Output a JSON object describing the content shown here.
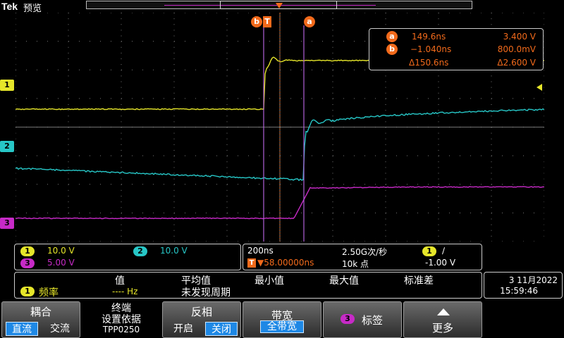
{
  "header": {
    "brand": "Tek",
    "mode": "预览"
  },
  "colors": {
    "ch1": "#e6e62a",
    "ch2": "#27c7c7",
    "ch3": "#c72ac7",
    "cursor": "#f26a1b",
    "grid": "#7a7a7a",
    "cursor_line": "#b060d8",
    "select": "#1e88e5"
  },
  "channel_markers": {
    "ch1": "1",
    "ch2": "2",
    "ch3": "3"
  },
  "trigger_marker": "T",
  "cursor_tags": {
    "a": "a",
    "b": "b"
  },
  "cursor_readout": {
    "a_time": "149.6ns",
    "a_value": "3.400 V",
    "b_time": "−1.040ns",
    "b_value": "800.0mV",
    "delta_time": "Δ150.6ns",
    "delta_value": "Δ2.600 V"
  },
  "channels": [
    {
      "id": "1",
      "scale": "10.0 V"
    },
    {
      "id": "2",
      "scale": "10.0 V"
    },
    {
      "id": "3",
      "scale": "5.00 V"
    }
  ],
  "timebase": {
    "scale": "200ns",
    "sample_rate": "2.50G次/秒",
    "trigger_position": "▼58.00000ns",
    "record_length": "10k 点",
    "trigger_source": "1",
    "trigger_slope": "∕",
    "trigger_level": "-1.00 V"
  },
  "measurement": {
    "headers": {
      "value": "值",
      "mean": "平均值",
      "min": "最小值",
      "max": "最大值",
      "std": "标准差"
    },
    "source": "1",
    "name": "频率",
    "value": "---- Hz",
    "mean": "未发现周期"
  },
  "clock": {
    "date": "3 11月2022",
    "time": "15:59:46"
  },
  "menu": {
    "coupling": {
      "title": "耦合",
      "opt1": "直流",
      "opt2": "交流"
    },
    "termination": {
      "line1": "终端",
      "line2": "设置依据",
      "line3": "TPP0250"
    },
    "invert": {
      "title": "反相",
      "opt1": "开启",
      "opt2": "关闭"
    },
    "bandwidth": {
      "title": "带宽",
      "value": "全带宽"
    },
    "label": {
      "source": "3",
      "title": "标签"
    },
    "more": {
      "title": "更多"
    }
  }
}
